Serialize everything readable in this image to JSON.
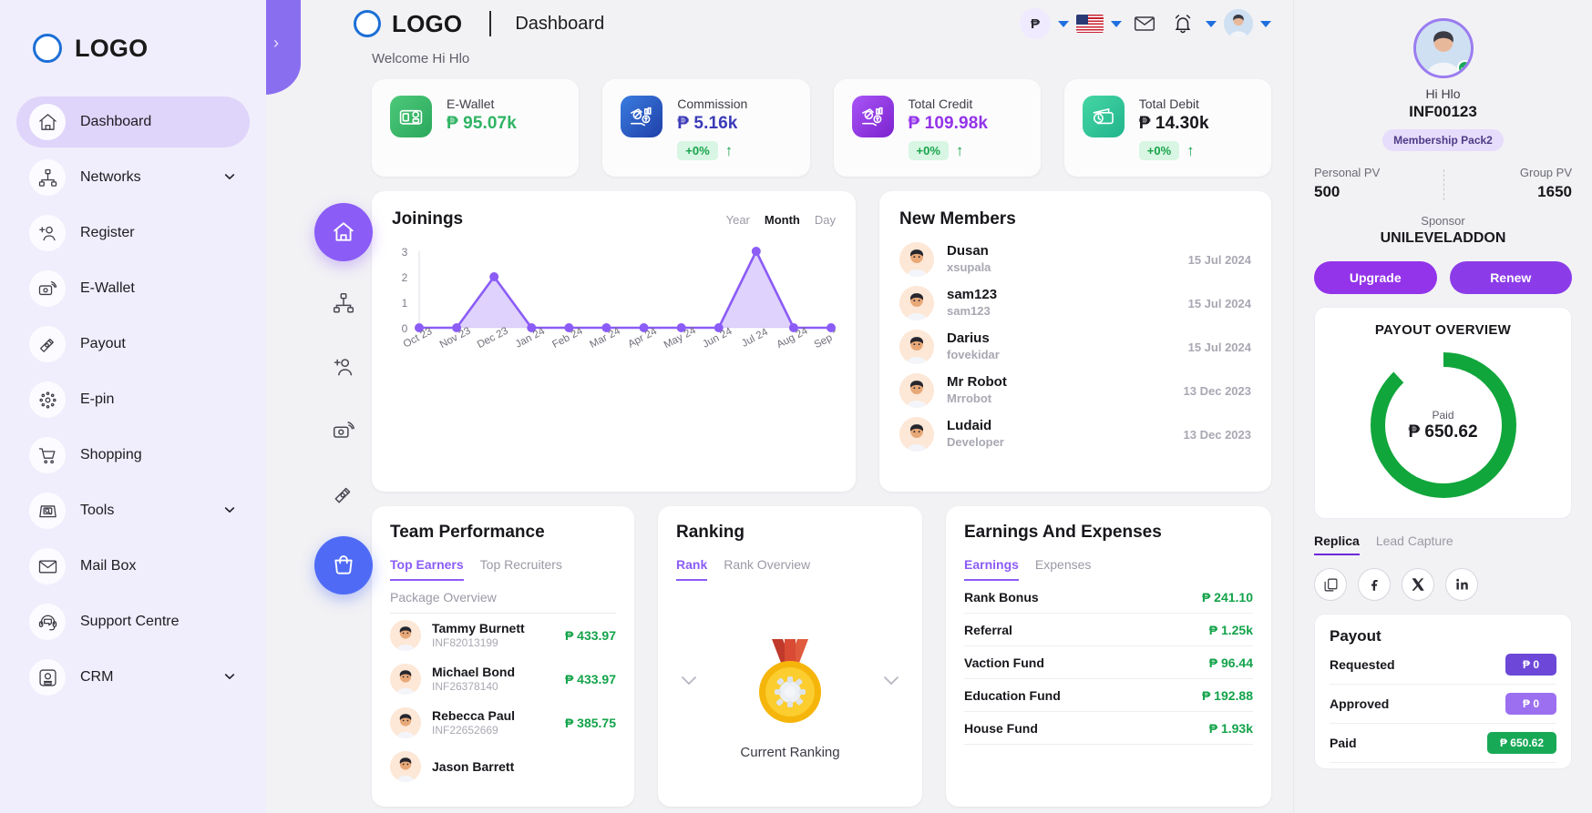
{
  "brand": {
    "logo_text": "LOGO"
  },
  "sidebar": {
    "items": [
      {
        "label": "Dashboard",
        "icon": "home-icon",
        "active": true,
        "expandable": false
      },
      {
        "label": "Networks",
        "icon": "network-icon",
        "active": false,
        "expandable": true
      },
      {
        "label": "Register",
        "icon": "add-user-icon",
        "active": false,
        "expandable": false
      },
      {
        "label": "E-Wallet",
        "icon": "wallet-icon",
        "active": false,
        "expandable": false
      },
      {
        "label": "Payout",
        "icon": "payout-icon",
        "active": false,
        "expandable": false
      },
      {
        "label": "E-pin",
        "icon": "epin-icon",
        "active": false,
        "expandable": false
      },
      {
        "label": "Shopping",
        "icon": "cart-icon",
        "active": false,
        "expandable": false
      },
      {
        "label": "Tools",
        "icon": "tools-icon",
        "active": false,
        "expandable": true
      },
      {
        "label": "Mail Box",
        "icon": "mail-icon",
        "active": false,
        "expandable": false
      },
      {
        "label": "Support Centre",
        "icon": "headset-icon",
        "active": false,
        "expandable": false
      },
      {
        "label": "CRM",
        "icon": "crm-icon",
        "active": false,
        "expandable": true
      }
    ]
  },
  "header": {
    "logo_text": "LOGO",
    "page_title": "Dashboard",
    "currency_symbol": "₱",
    "language_flag": "us-flag-icon",
    "welcome": "Welcome Hi Hlo"
  },
  "stats": [
    {
      "label": "E-Wallet",
      "value": "₱ 95.07k",
      "color": "#2fb463",
      "icon_bg": "linear-gradient(135deg,#4ec97a,#2aa85c)",
      "change": "",
      "show_change": false
    },
    {
      "label": "Commission",
      "value": "₱ 5.16k",
      "color": "#3b3bb8",
      "icon_bg": "linear-gradient(135deg,#3a7de0,#1f3fa8)",
      "change": "+0%",
      "show_change": true
    },
    {
      "label": "Total Credit",
      "value": "₱ 109.98k",
      "color": "#9333ea",
      "icon_bg": "linear-gradient(135deg,#a855f7,#7c22ce)",
      "change": "+0%",
      "show_change": true
    },
    {
      "label": "Total Debit",
      "value": "₱ 14.30k",
      "color": "#17171c",
      "icon_bg": "linear-gradient(135deg,#46d6a5,#21b48b)",
      "change": "+0%",
      "show_change": true
    }
  ],
  "joinings": {
    "title": "Joinings",
    "range_options": [
      "Year",
      "Month",
      "Day"
    ],
    "selected_range": "Month"
  },
  "chart_data": {
    "type": "line",
    "title": "Joinings",
    "x": [
      "Oct 23",
      "Nov 23",
      "Dec 23",
      "Jan 24",
      "Feb 24",
      "Mar 24",
      "Apr 24",
      "May 24",
      "Jun 24",
      "Jul 24",
      "Aug 24",
      "Sep 24"
    ],
    "values": [
      0,
      0,
      2,
      0,
      0,
      0,
      0,
      0,
      0,
      3,
      0,
      0
    ],
    "ylabel": "",
    "xlabel": "",
    "yticks": [
      0,
      1,
      2,
      3
    ],
    "ylim": [
      0,
      3
    ],
    "grid": false,
    "legend": "none",
    "line_color": "#8b5cf6",
    "fill_color": "rgba(139,92,246,0.28)"
  },
  "new_members": {
    "title": "New Members",
    "rows": [
      {
        "name": "Dusan",
        "username": "xsupala",
        "date": "15 Jul 2024"
      },
      {
        "name": "sam123",
        "username": "sam123",
        "date": "15 Jul 2024"
      },
      {
        "name": "Darius",
        "username": "fovekidar",
        "date": "15 Jul 2024"
      },
      {
        "name": "Mr Robot",
        "username": "Mrrobot",
        "date": "13 Dec 2023"
      },
      {
        "name": "Ludaid",
        "username": "Developer",
        "date": "13 Dec 2023"
      }
    ]
  },
  "team_performance": {
    "title": "Team Performance",
    "tabs": [
      "Top Earners",
      "Top Recruiters"
    ],
    "active_tab": "Top Earners",
    "subheader": "Package Overview",
    "rows": [
      {
        "name": "Tammy Burnett",
        "id": "INF82013199",
        "amount": "₱ 433.97"
      },
      {
        "name": "Michael Bond",
        "id": "INF26378140",
        "amount": "₱ 433.97"
      },
      {
        "name": "Rebecca Paul",
        "id": "INF22652669",
        "amount": "₱ 385.75"
      },
      {
        "name": "Jason Barrett",
        "id": "",
        "amount": ""
      }
    ]
  },
  "ranking": {
    "title": "Ranking",
    "tabs": [
      "Rank",
      "Rank Overview"
    ],
    "active_tab": "Rank",
    "caption": "Current Ranking"
  },
  "earnings": {
    "title": "Earnings And Expenses",
    "tabs": [
      "Earnings",
      "Expenses"
    ],
    "active_tab": "Earnings",
    "rows": [
      {
        "name": "Rank Bonus",
        "value": "₱ 241.10"
      },
      {
        "name": "Referral",
        "value": "₱ 1.25k"
      },
      {
        "name": "Vaction Fund",
        "value": "₱ 96.44"
      },
      {
        "name": "Education Fund",
        "value": "₱ 192.88"
      },
      {
        "name": "House Fund",
        "value": "₱ 1.93k"
      }
    ]
  },
  "profile": {
    "greeting": "Hi Hlo",
    "member_id": "INF00123",
    "membership": "Membership Pack2",
    "personal_pv_label": "Personal PV",
    "personal_pv": "500",
    "group_pv_label": "Group PV",
    "group_pv": "1650",
    "sponsor_label": "Sponsor",
    "sponsor": "UNILEVELADDON",
    "upgrade_label": "Upgrade",
    "renew_label": "Renew"
  },
  "payout_overview": {
    "title": "PAYOUT OVERVIEW",
    "center_label": "Paid",
    "center_value": "₱ 650.62",
    "ring_color": "#11a63b",
    "percent": 88
  },
  "replica": {
    "tabs": [
      "Replica",
      "Lead Capture"
    ],
    "active_tab": "Replica",
    "socials": [
      "copy-icon",
      "facebook-icon",
      "x-twitter-icon",
      "linkedin-icon"
    ]
  },
  "payout": {
    "title": "Payout",
    "rows": [
      {
        "label": "Requested",
        "value": "₱ 0",
        "chip_color": "#6d48d8"
      },
      {
        "label": "Approved",
        "value": "₱ 0",
        "chip_color": "#9b6ff0"
      },
      {
        "label": "Paid",
        "value": "₱ 650.62",
        "chip_color": "#18a957"
      }
    ]
  }
}
